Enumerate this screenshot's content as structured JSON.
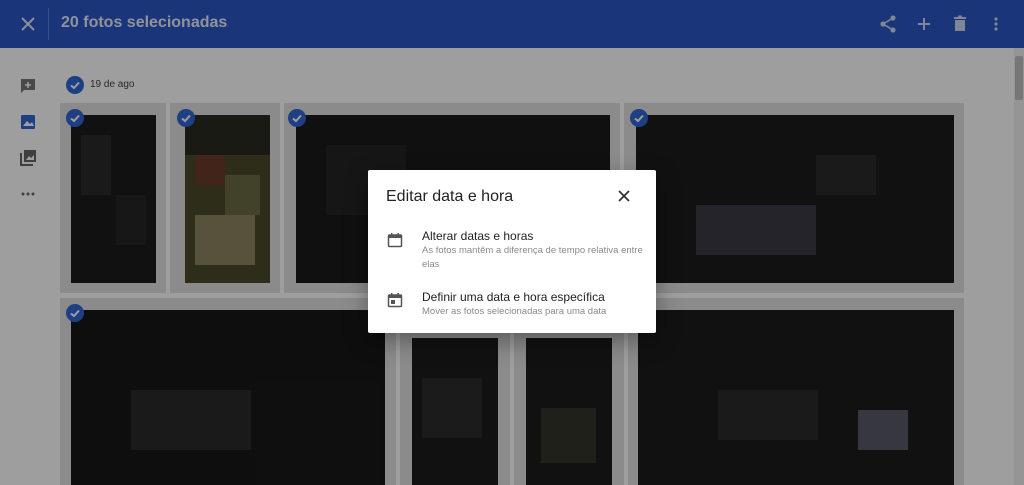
{
  "toolbar": {
    "title": "20 fotos selecionadas",
    "close_icon": "close-icon",
    "actions": [
      "share-icon",
      "add-icon",
      "delete-icon",
      "more-vert-icon"
    ]
  },
  "side_rail": {
    "items": [
      "add-comment-icon",
      "photo-icon",
      "photo-library-icon",
      "more-horiz-icon"
    ]
  },
  "content": {
    "date_group": "19 de ago"
  },
  "dialog": {
    "title": "Editar data e hora",
    "close_icon": "close-icon",
    "options": [
      {
        "title": "Alterar datas e horas",
        "description": "As fotos mantêm a diferença de tempo relativa entre elas",
        "icon": "calendar-icon"
      },
      {
        "title": "Definir uma data e hora específica",
        "description": "Mover as fotos selecionadas para uma data",
        "icon": "calendar-event-icon"
      }
    ]
  },
  "colors": {
    "toolbar": "#2a56c6",
    "accent": "#3367d6",
    "scrim": "rgba(0,0,0,0.38)"
  }
}
